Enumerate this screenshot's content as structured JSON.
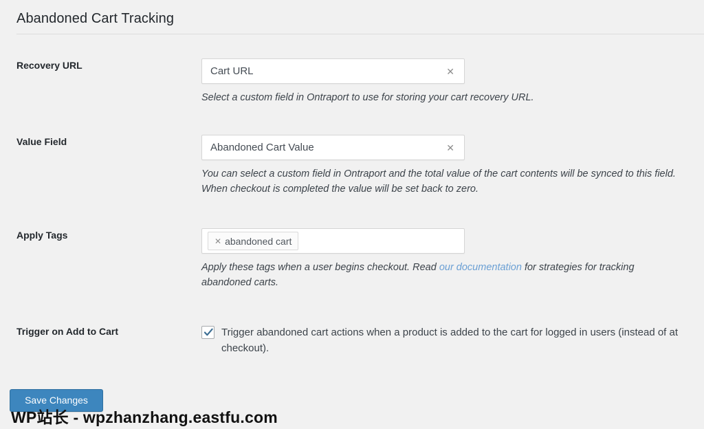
{
  "section": {
    "title": "Abandoned Cart Tracking"
  },
  "fields": {
    "recovery_url": {
      "label": "Recovery URL",
      "value": "Cart URL",
      "clear_icon": "close-x-icon",
      "help": "Select a custom field in Ontraport to use for storing your cart recovery URL."
    },
    "value_field": {
      "label": "Value Field",
      "value": "Abandoned Cart Value",
      "clear_icon": "close-x-icon",
      "help": "You can select a custom field in Ontraport and the total value of the cart contents will be synced to this field. When checkout is completed the value will be set back to zero."
    },
    "apply_tags": {
      "label": "Apply Tags",
      "tags": [
        {
          "remove_icon": "close-x-icon",
          "label": "abandoned cart"
        }
      ],
      "help_before_link": "Apply these tags when a user begins checkout. Read ",
      "link_text": "our documentation",
      "help_after_link": " for strategies for tracking abandoned carts."
    },
    "trigger_add_to_cart": {
      "label": "Trigger on Add to Cart",
      "checked": true,
      "check_icon": "checkmark-icon",
      "description": "Trigger abandoned cart actions when a product is added to the cart for logged in users (instead of at checkout)."
    }
  },
  "actions": {
    "save_label": "Save Changes"
  },
  "watermark": {
    "text": "WP站长 - wpzhanzhang.eastfu.com"
  },
  "colors": {
    "page_background": "#f1f1f1",
    "primary_button": "#3d86be",
    "link": "#6a9fd4",
    "checkmark": "#3c6e93",
    "label_text": "#23282d",
    "help_text": "#3c434a",
    "input_border": "#d5d5d5"
  }
}
